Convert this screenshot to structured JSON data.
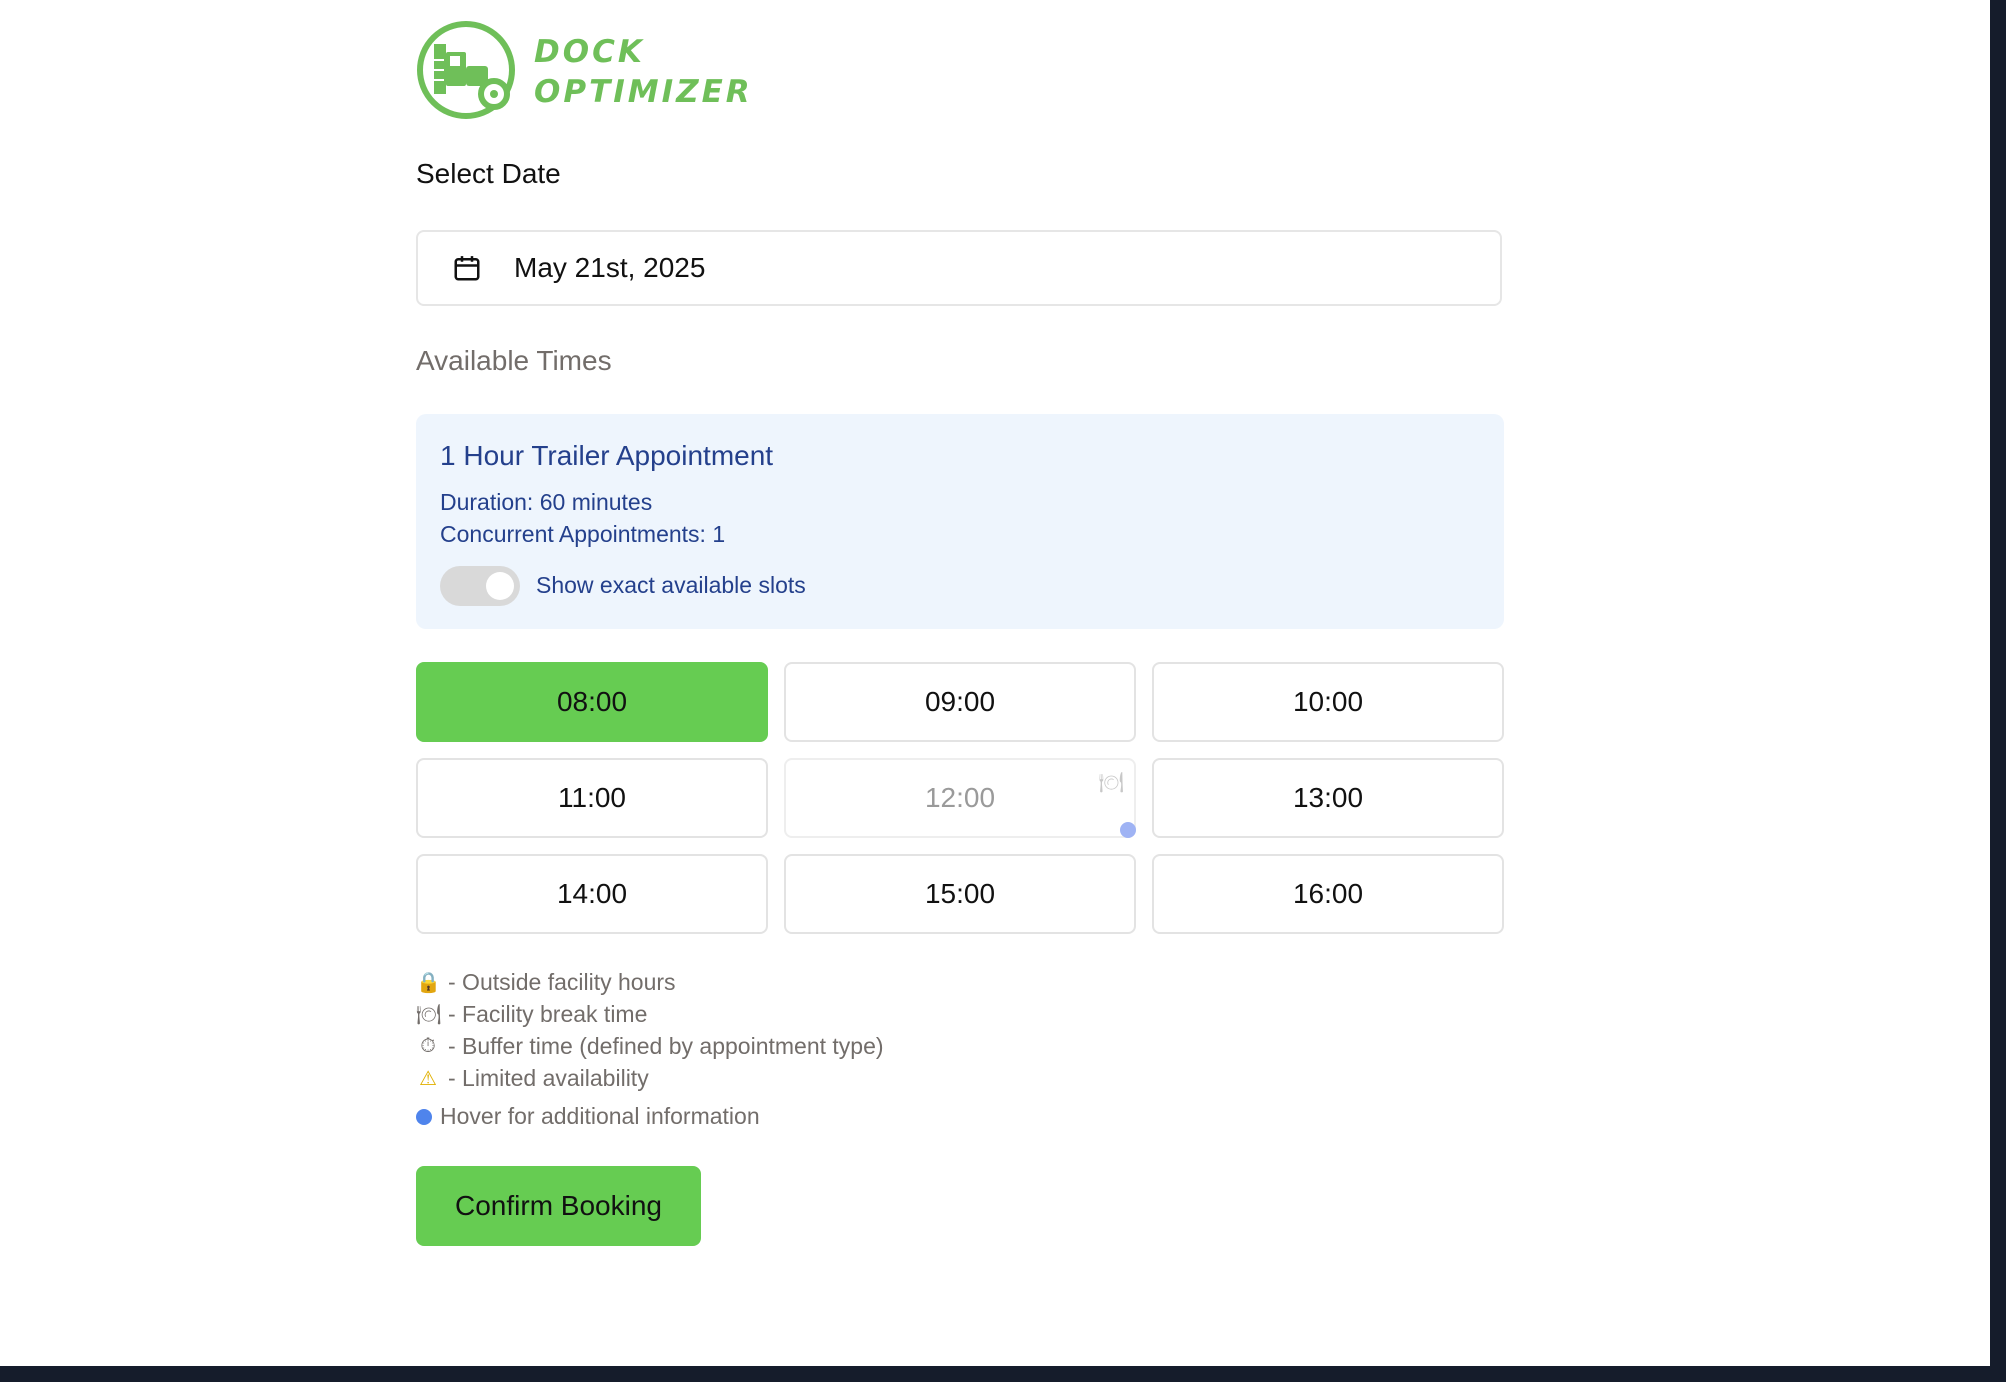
{
  "brand": {
    "line1": "DOCK",
    "line2": "OPTIMIZER",
    "color": "#6fbf59"
  },
  "date_section": {
    "label": "Select Date",
    "value": "May 21st, 2025",
    "icon": "calendar-icon"
  },
  "times_section": {
    "label": "Available Times"
  },
  "appointment": {
    "title": "1 Hour Trailer Appointment",
    "duration": "Duration: 60 minutes",
    "concurrent": "Concurrent Appointments: 1",
    "toggle_label": "Show exact available slots",
    "toggle_on": false
  },
  "slots": [
    {
      "time": "08:00",
      "state": "selected"
    },
    {
      "time": "09:00",
      "state": "available"
    },
    {
      "time": "10:00",
      "state": "available"
    },
    {
      "time": "11:00",
      "state": "available"
    },
    {
      "time": "12:00",
      "state": "break",
      "icon": "break-icon"
    },
    {
      "time": "13:00",
      "state": "available"
    },
    {
      "time": "14:00",
      "state": "available"
    },
    {
      "time": "15:00",
      "state": "available"
    },
    {
      "time": "16:00",
      "state": "available"
    }
  ],
  "legend": [
    {
      "icon": "lock-icon",
      "glyph": "🔒",
      "text": "- Outside facility hours"
    },
    {
      "icon": "plate-icon",
      "glyph": "🍽",
      "text": "- Facility break time"
    },
    {
      "icon": "timer-icon",
      "glyph": "⏱",
      "text": "- Buffer time (defined by appointment type)"
    },
    {
      "icon": "warning-icon",
      "glyph": "⚠",
      "text": "- Limited availability"
    }
  ],
  "hover_hint": "Hover for additional information",
  "confirm_label": "Confirm Booking",
  "colors": {
    "accent": "#66cc52",
    "info_bg": "#eef5fd",
    "info_text": "#24408c",
    "dot": "#4f84ec"
  }
}
